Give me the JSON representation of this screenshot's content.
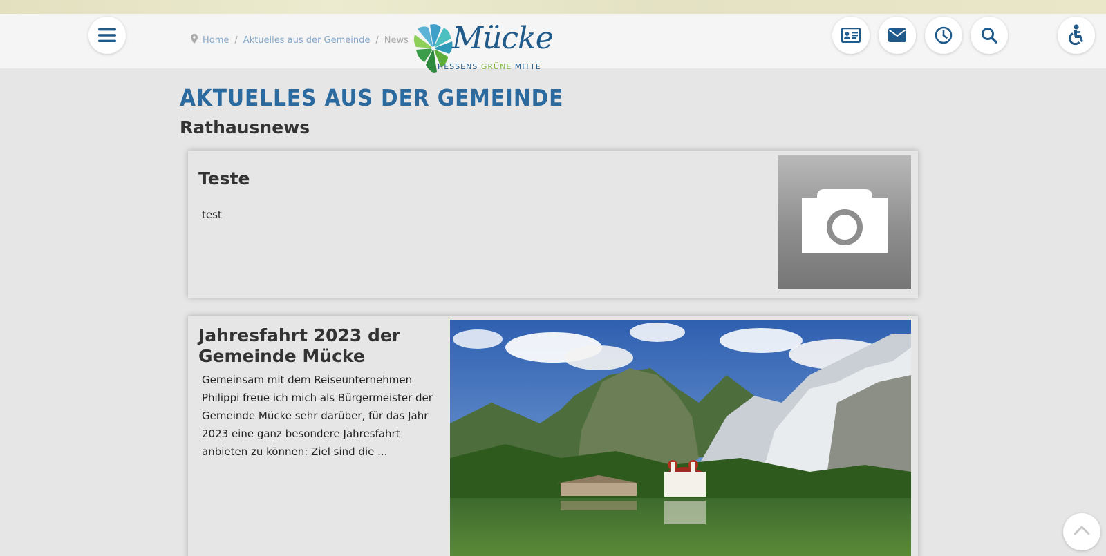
{
  "breadcrumb": {
    "home": "Home",
    "section": "Aktuelles aus der Gemeinde",
    "current": "News",
    "separator": "/"
  },
  "logo": {
    "word": "Mücke",
    "tagline_a": "HESSENS ",
    "tagline_b": "GRÜNE",
    "tagline_c": " MITTE"
  },
  "page": {
    "heading": "Aktuelles aus der Gemeinde",
    "subheading": "Rathausnews"
  },
  "news": [
    {
      "title": "Teste",
      "teaser": "test"
    },
    {
      "title_line1": "Jahresfahrt 2023 der",
      "title_line2": "Gemeinde Mücke",
      "teaser": "Gemeinsam mit dem Reiseunternehmen Philippi freue ich mich als Bürgermeister der Gemeinde Mücke sehr darüber, für das Jahr 2023 eine ganz besondere Jahresfahrt anbieten zu können: Ziel sind die ..."
    }
  ],
  "icons": {
    "menu": "menu-icon",
    "contact_card": "contact-card-icon",
    "mail": "mail-icon",
    "clock": "clock-icon",
    "search": "search-icon",
    "accessibility": "accessibility-icon",
    "camera": "camera-icon",
    "chevron_up": "chevron-up-icon",
    "pin": "map-pin-icon"
  },
  "colors": {
    "brand_blue": "#2b6a9e",
    "icon_blue": "#1f5a8a",
    "brand_green": "#7fb23a",
    "background": "#e6e6e6",
    "header": "#f5f5f5"
  }
}
